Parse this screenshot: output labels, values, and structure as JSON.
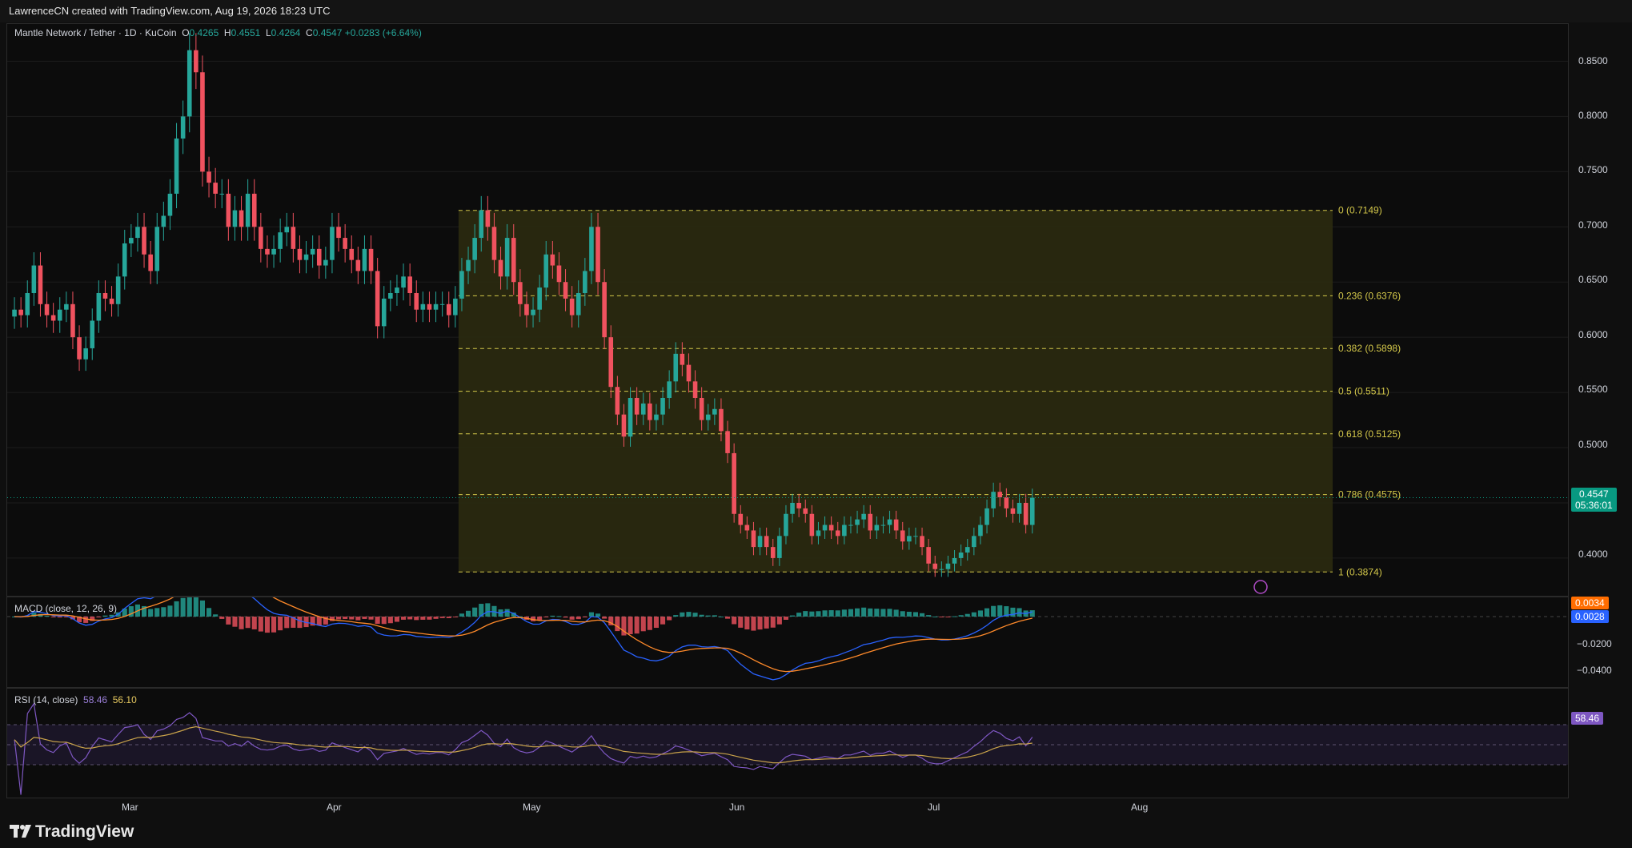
{
  "attribution": "LawrenceCN created with TradingView.com, Aug 19, 2026 18:23 UTC",
  "symbol": {
    "pair": "Mantle Network / Tether · 1D · KuCoin",
    "open_label": "O",
    "open": "0.4265",
    "high_label": "H",
    "high": "0.4551",
    "low_label": "L",
    "low": "0.4264",
    "close_label": "C",
    "close": "0.4547",
    "change": "+0.0283 (+6.64%)"
  },
  "colors": {
    "up": "#26a69a",
    "down": "#f0525f",
    "fib": "#d4c84a",
    "fib_zone": "#2b2a0f",
    "macd": "#2962ff",
    "signal": "#ff8a2a",
    "rsi": "#7e57c2",
    "rsi_ma": "#c8a24a",
    "price_tag": "#089981",
    "orange_tag": "#ff6d00"
  },
  "price_axis": {
    "labels": [
      "0.8500",
      "0.8000",
      "0.7500",
      "0.7000",
      "0.6500",
      "0.6000",
      "0.5500",
      "0.5000",
      "0.4000"
    ],
    "last_price": "0.4547",
    "countdown": "05:36:01"
  },
  "macd": {
    "legend": "MACD (close, 12, 26, 9)",
    "axis": [
      "−0.0200",
      "−0.0400"
    ],
    "tag_macd": "0.0034",
    "tag_signal": "0.0028"
  },
  "rsi": {
    "legend": "RSI (14, close)",
    "value": "58.46",
    "ma": "56.10",
    "tag": "58.46"
  },
  "time_axis": [
    "Mar",
    "Apr",
    "May",
    "Jun",
    "Jul",
    "Aug"
  ],
  "brand": "TradingView",
  "chart_data": {
    "type": "candlestick",
    "title": "Mantle Network / Tether · 1D · KuCoin",
    "ylim": [
      0.376,
      0.875
    ],
    "fib_levels": [
      {
        "ratio": "0",
        "price": 0.7149,
        "label": "0 (0.7149)"
      },
      {
        "ratio": "0.236",
        "price": 0.6376,
        "label": "0.236 (0.6376)"
      },
      {
        "ratio": "0.382",
        "price": 0.5898,
        "label": "0.382 (0.5898)"
      },
      {
        "ratio": "0.5",
        "price": 0.5511,
        "label": "0.5 (0.5511)"
      },
      {
        "ratio": "0.618",
        "price": 0.5125,
        "label": "0.618 (0.5125)"
      },
      {
        "ratio": "0.786",
        "price": 0.4575,
        "label": "0.786 (0.4575)"
      },
      {
        "ratio": "1",
        "price": 0.3874,
        "label": "1 (0.3874)"
      }
    ],
    "closes": [
      0.625,
      0.62,
      0.64,
      0.665,
      0.63,
      0.62,
      0.615,
      0.625,
      0.63,
      0.6,
      0.58,
      0.59,
      0.615,
      0.64,
      0.635,
      0.63,
      0.655,
      0.685,
      0.69,
      0.7,
      0.675,
      0.66,
      0.7,
      0.71,
      0.73,
      0.78,
      0.8,
      0.86,
      0.84,
      0.75,
      0.74,
      0.73,
      0.73,
      0.7,
      0.715,
      0.7,
      0.73,
      0.7,
      0.68,
      0.675,
      0.68,
      0.695,
      0.7,
      0.68,
      0.67,
      0.675,
      0.68,
      0.665,
      0.67,
      0.7,
      0.69,
      0.68,
      0.67,
      0.66,
      0.68,
      0.66,
      0.61,
      0.635,
      0.64,
      0.645,
      0.655,
      0.64,
      0.625,
      0.63,
      0.625,
      0.63,
      0.63,
      0.62,
      0.635,
      0.66,
      0.67,
      0.69,
      0.715,
      0.7,
      0.67,
      0.655,
      0.69,
      0.65,
      0.63,
      0.62,
      0.625,
      0.645,
      0.675,
      0.665,
      0.65,
      0.635,
      0.62,
      0.64,
      0.66,
      0.7,
      0.65,
      0.6,
      0.555,
      0.53,
      0.51,
      0.545,
      0.53,
      0.54,
      0.525,
      0.53,
      0.545,
      0.56,
      0.585,
      0.575,
      0.56,
      0.545,
      0.525,
      0.53,
      0.535,
      0.515,
      0.495,
      0.44,
      0.43,
      0.425,
      0.41,
      0.42,
      0.41,
      0.4,
      0.42,
      0.44,
      0.45,
      0.445,
      0.44,
      0.42,
      0.425,
      0.43,
      0.425,
      0.42,
      0.43,
      0.43,
      0.435,
      0.44,
      0.425,
      0.43,
      0.43,
      0.435,
      0.425,
      0.415,
      0.42,
      0.42,
      0.41,
      0.395,
      0.39,
      0.39,
      0.395,
      0.4,
      0.405,
      0.41,
      0.42,
      0.43,
      0.445,
      0.46,
      0.455,
      0.445,
      0.44,
      0.45,
      0.43,
      0.4547
    ]
  }
}
